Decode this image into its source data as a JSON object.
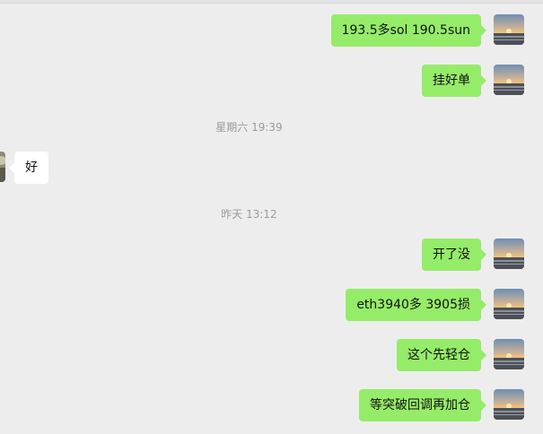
{
  "timestamps": [
    "星期六 19:39",
    "昨天 13:12"
  ],
  "messages": [
    {
      "sender": "me",
      "text": "193.5多sol 190.5sun"
    },
    {
      "sender": "me",
      "text": "挂好单"
    },
    {
      "sender": "other",
      "text": "好"
    },
    {
      "sender": "me",
      "text": "开了没"
    },
    {
      "sender": "me",
      "text": "eth3940多 3905损"
    },
    {
      "sender": "me",
      "text": "这个先轻仓"
    },
    {
      "sender": "me",
      "text": "等突破回调再加仓"
    }
  ],
  "colors": {
    "background": "#ededed",
    "my_bubble": "#95ec69",
    "other_bubble": "#ffffff",
    "timestamp": "#9b9b9b"
  },
  "icons": {
    "my_avatar": "sunset-avatar",
    "other_avatar": "contact-avatar"
  }
}
